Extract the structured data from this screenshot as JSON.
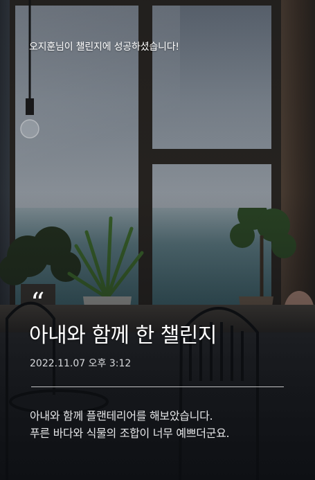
{
  "banner": {
    "message": "오지훈님이 챌린지에 성공하셨습니다!"
  },
  "post": {
    "quote_mark": "“",
    "title": "아내와 함께 한 챌린지",
    "datetime": "2022.11.07 오후 3:12",
    "body_lines": [
      "아내와 함께 플랜테리어를 해보았습니다.",
      "푸른 바다와 식물의 조합이 너무 예쁘더군요."
    ]
  },
  "background": {
    "description_icon": "cafe-window-sea-plants-photo"
  }
}
